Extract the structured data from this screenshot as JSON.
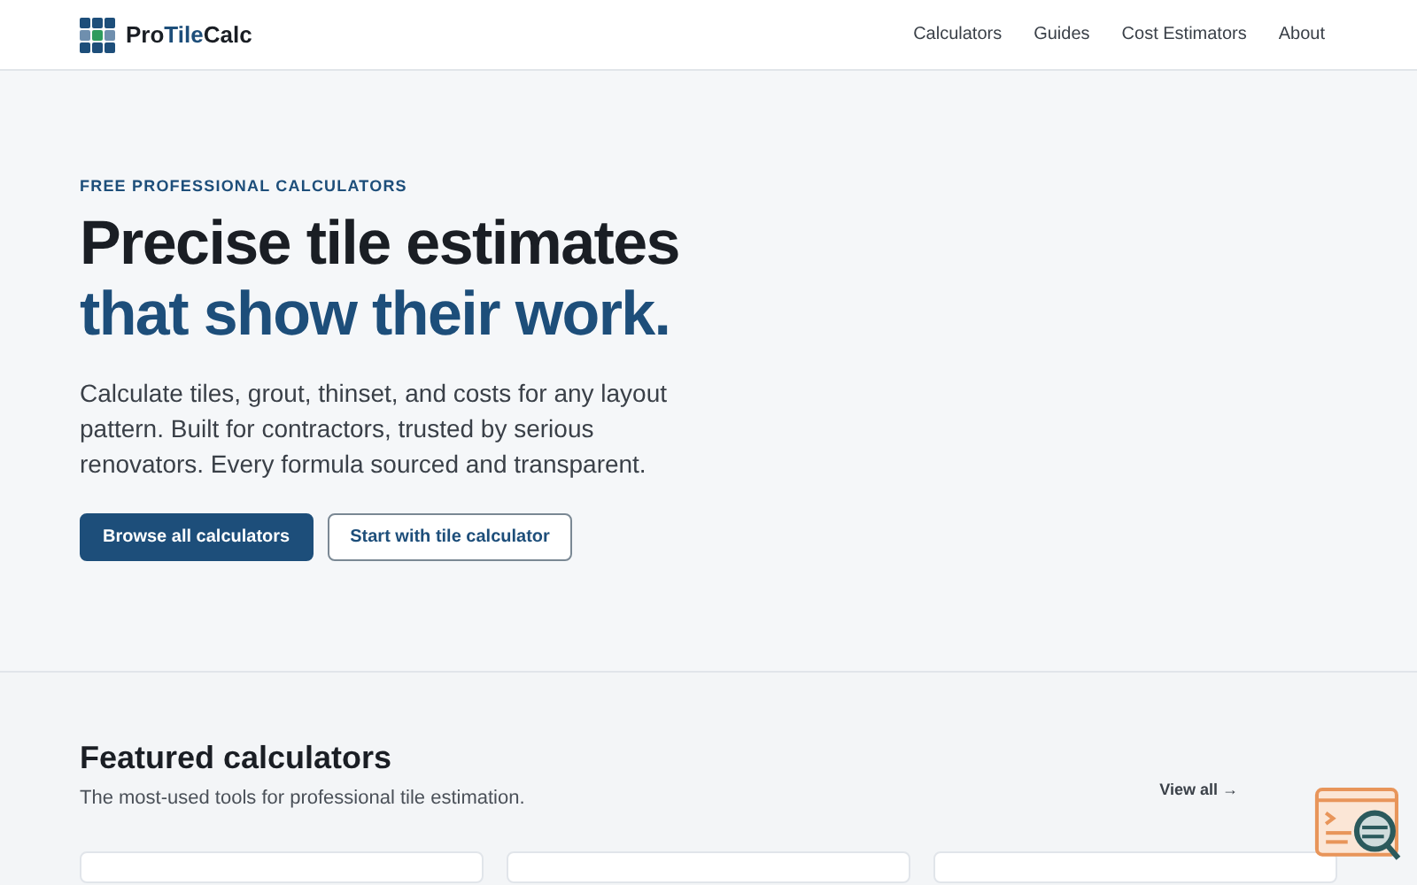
{
  "header": {
    "brand": {
      "prefix": "Pro",
      "accent": "Tile",
      "suffix": "Calc"
    },
    "nav": [
      {
        "label": "Calculators"
      },
      {
        "label": "Guides"
      },
      {
        "label": "Cost Estimators"
      },
      {
        "label": "About"
      }
    ]
  },
  "hero": {
    "eyebrow": "FREE PROFESSIONAL CALCULATORS",
    "headline": [
      "Precise tile estimates",
      "that show their work."
    ],
    "lead": "Calculate tiles, grout, thinset, and costs for any layout pattern. Built for contractors, trusted by serious renovators. Every formula sourced and transparent.",
    "buttons": [
      {
        "label": "Browse all calculators",
        "kind": "primary"
      },
      {
        "label": "Start with tile calculator",
        "kind": "secondary"
      }
    ]
  },
  "featured": {
    "title": "Featured calculators",
    "subtitle": "The most-used tools for professional tile estimation.",
    "view_all": "View all →"
  }
}
